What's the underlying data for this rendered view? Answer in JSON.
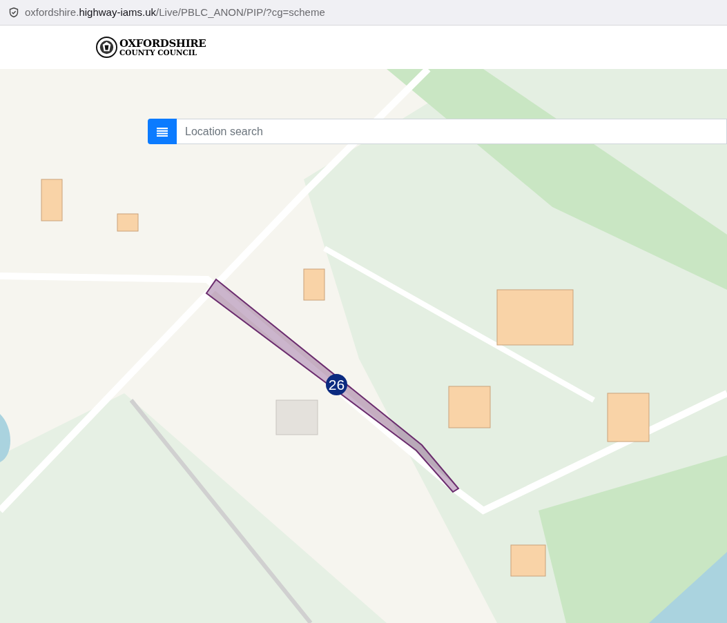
{
  "browser": {
    "url": "oxfordshire.**highway-iams.uk**/Live/PBLC_ANON/PIP/?cg=scheme"
  },
  "header": {
    "logo_line_1": "OXFORDSHIRE",
    "logo_line_2": "COUNTY COUNCIL"
  },
  "search": {
    "placeholder": "Location search"
  },
  "map": {
    "schemes": [
      {
        "marker": "26",
        "color": "#6b2c6e"
      }
    ]
  }
}
